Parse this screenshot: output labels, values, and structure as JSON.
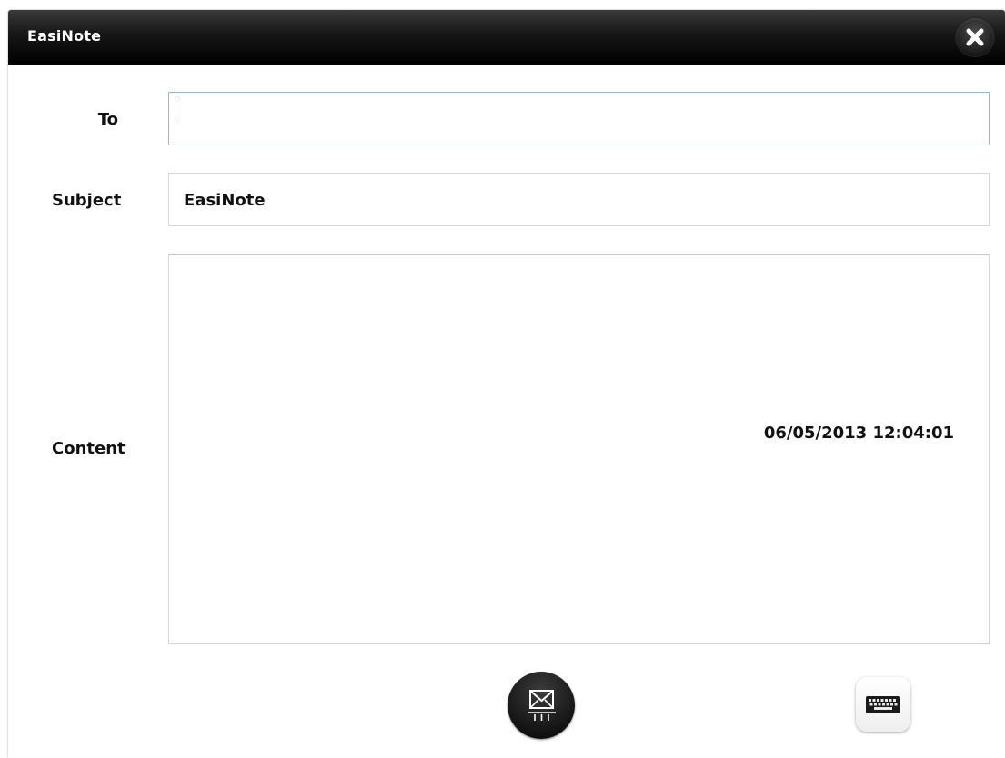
{
  "window": {
    "title": "EasiNote"
  },
  "form": {
    "to_label": "To",
    "to_value": "",
    "subject_label": "Subject",
    "subject_value": "EasiNote",
    "content_label": "Content",
    "content_timestamp": "06/05/2013 12:04:01"
  },
  "icons": {
    "close": "close-icon",
    "send": "send-mail-icon",
    "keyboard": "keyboard-icon"
  },
  "colors": {
    "titlebar": "#000000",
    "to_focus_border": "#8fb9d9"
  }
}
